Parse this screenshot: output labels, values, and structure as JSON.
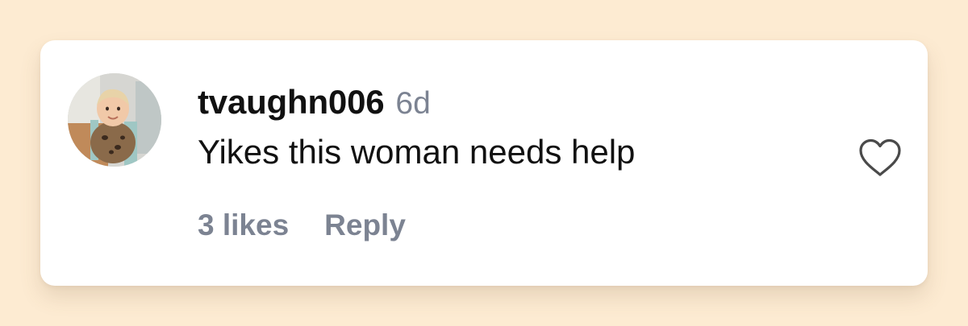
{
  "comment": {
    "username": "tvaughn006",
    "timestamp": "6d",
    "text": "Yikes this woman needs help",
    "likes_label": "3 likes",
    "reply_label": "Reply",
    "avatar_icon": "user-avatar-photo",
    "like_icon": "heart-outline-icon"
  },
  "colors": {
    "page_background": "#fdebd2",
    "card_background": "#ffffff",
    "primary_text": "#111111",
    "secondary_text": "#7c8392",
    "icon_stroke": "#4a4a4a"
  }
}
